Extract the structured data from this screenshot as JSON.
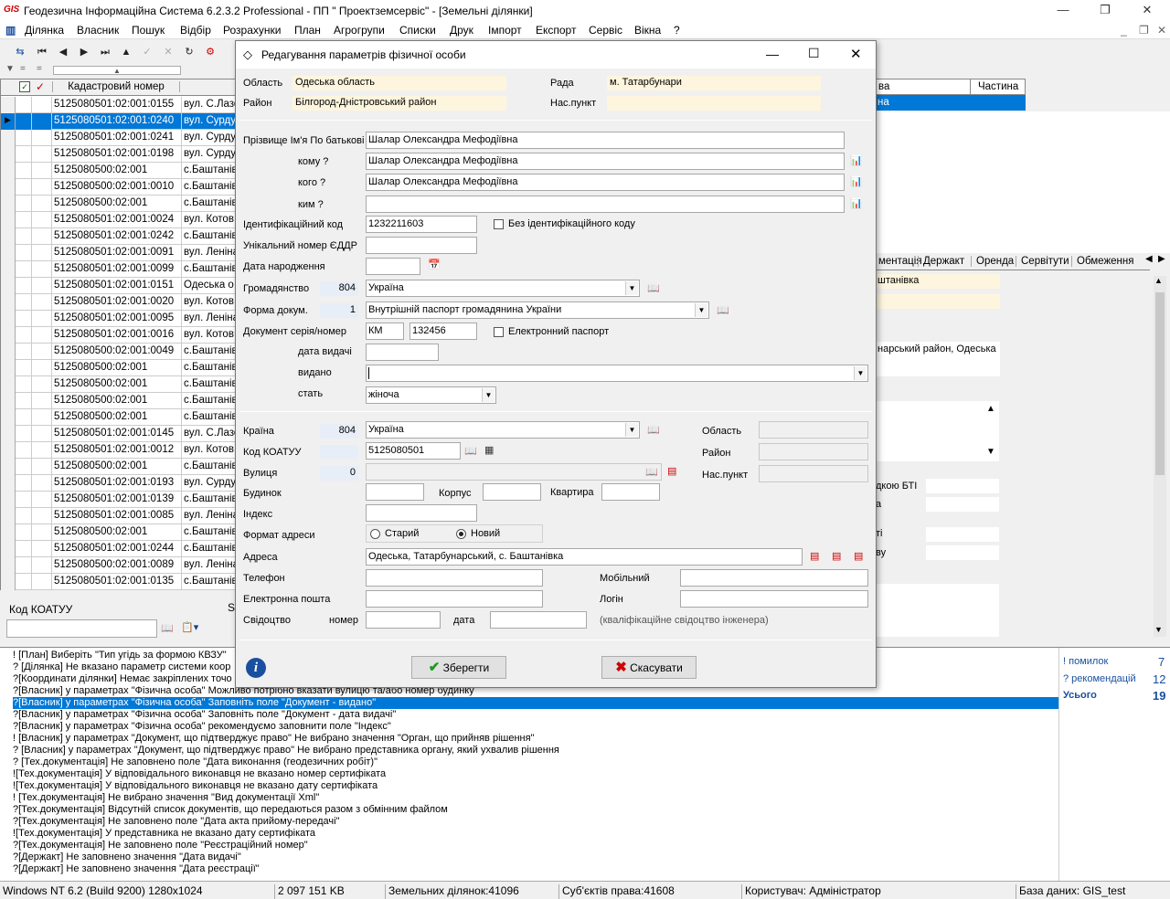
{
  "app": {
    "logo": "GIS",
    "title": "Геодезична Інформаційна Система  6.2.3.2 Professional - ПП \" Проектземсервіс\" - [Земельні ділянки]"
  },
  "menu": [
    "Ділянка",
    "Власник",
    "Пошук",
    "Відбір",
    "Розрахунки",
    "План",
    "Агрогрупи",
    "Списки",
    "Друк",
    "Імпорт",
    "Експорт",
    "Сервіс",
    "Вікна",
    "?"
  ],
  "grid": {
    "header_cad": "Кадастровий номер",
    "rows": [
      {
        "cad": "5125080501:02:001:0155",
        "addr": "вул. С.Лазо"
      },
      {
        "cad": "5125080501:02:001:0240",
        "addr": "вул. Сурдул",
        "selected": true
      },
      {
        "cad": "5125080501:02:001:0241",
        "addr": "вул. Сурдул"
      },
      {
        "cad": "5125080501:02:001:0198",
        "addr": "вул. Сурдул"
      },
      {
        "cad": "5125080500:02:001",
        "addr": "с.Баштанів"
      },
      {
        "cad": "5125080500:02:001:0010",
        "addr": "с.Баштанів"
      },
      {
        "cad": "5125080500:02:001",
        "addr": "с.Баштанів"
      },
      {
        "cad": "5125080501:02:001:0024",
        "addr": "вул. Котов"
      },
      {
        "cad": "5125080501:02:001:0242",
        "addr": "с.Баштанів"
      },
      {
        "cad": "5125080501:02:001:0091",
        "addr": "вул. Леніна"
      },
      {
        "cad": "5125080501:02:001:0099",
        "addr": "с.Баштанів"
      },
      {
        "cad": "5125080501:02:001:0151",
        "addr": "Одеська о"
      },
      {
        "cad": "5125080501:02:001:0020",
        "addr": "вул. Котов"
      },
      {
        "cad": "5125080501:02:001:0095",
        "addr": "вул. Леніна"
      },
      {
        "cad": "5125080501:02:001:0016",
        "addr": "вул. Котов"
      },
      {
        "cad": "5125080500:02:001:0049",
        "addr": "с.Баштанів"
      },
      {
        "cad": "5125080500:02:001",
        "addr": "с.Баштанів"
      },
      {
        "cad": "5125080500:02:001",
        "addr": "с.Баштанів"
      },
      {
        "cad": "5125080500:02:001",
        "addr": "с.Баштанів"
      },
      {
        "cad": "5125080500:02:001",
        "addr": "с.Баштанів"
      },
      {
        "cad": "5125080501:02:001:0145",
        "addr": "вул. С.Лазо"
      },
      {
        "cad": "5125080501:02:001:0012",
        "addr": "вул. Котов"
      },
      {
        "cad": "5125080500:02:001",
        "addr": "с.Баштанів"
      },
      {
        "cad": "5125080501:02:001:0193",
        "addr": "вул. Сурдул"
      },
      {
        "cad": "5125080501:02:001:0139",
        "addr": "с.Баштанів"
      },
      {
        "cad": "5125080501:02:001:0085",
        "addr": "вул. Леніна"
      },
      {
        "cad": "5125080500:02:001",
        "addr": "с.Баштанів"
      },
      {
        "cad": "5125080501:02:001:0244",
        "addr": "с.Баштанів"
      },
      {
        "cad": "5125080500:02:001:0089",
        "addr": "вул. Леніна"
      },
      {
        "cad": "5125080501:02:001:0135",
        "addr": "с.Баштанів"
      }
    ]
  },
  "left_footer": {
    "koatuu_label": "Код КОАТУУ",
    "s": "S"
  },
  "right_pane": {
    "col_a": "ва",
    "col_b": "Частина",
    "sel_a": "на",
    "tabs": [
      "ментація",
      "Держакт",
      "Оренда",
      "Сервітути",
      "Обмеження"
    ],
    "field1": "штанівка",
    "field2": "нарський район, Одеська",
    "label_bti": "дкою БТІ",
    "label_a": "а",
    "label_ti": "ті",
    "label_vu": "ву"
  },
  "dialog": {
    "title": "Редагування параметрів фізичної особи",
    "oblast_label": "Область",
    "oblast": "Одеська область",
    "rada_label": "Рада",
    "rada": "м. Татарбунари",
    "raion_label": "Район",
    "raion": "Білгород-Дністровський район",
    "naspunkt_label": "Нас.пункт",
    "naspunkt": "",
    "pib_label": "Прізвище Ім'я По батькові",
    "pib": "Шалар Олександра Мефодіївна",
    "komu_label": "кому ?",
    "komu": "Шалар Олександра Мефодіївна",
    "koho_label": "кого ?",
    "koho": "Шалар Олександра Мефодіївна",
    "kym_label": "ким ?",
    "kym": "",
    "idcode_label": "Ідентифікаційний код",
    "idcode": "1232211603",
    "no_id_label": "Без ідентифікаційного коду",
    "eddr_label": "Унікальний номер ЄДДР",
    "eddr": "",
    "birth_label": "Дата народження",
    "birth": "",
    "citizen_label": "Громадянство",
    "citizen_code": "804",
    "citizen": "Україна",
    "doctype_label": "Форма докум.",
    "doctype_code": "1",
    "doctype": "Внутрішній паспорт громадянина України",
    "docnum_label": "Документ серія/номер",
    "doc_series": "КМ",
    "doc_number": "132456",
    "epass_label": "Електронний паспорт",
    "issued_date_label": "дата видачі",
    "issued_date": "",
    "issued_by_label": "видано",
    "issued_by": "",
    "sex_label": "стать",
    "sex": "жіноча",
    "country_label": "Країна",
    "country_code": "804",
    "country": "Україна",
    "oblast2_label": "Область",
    "raion2_label": "Район",
    "naspunkt2_label": "Нас.пункт",
    "koatuu_label": "Код КОАТУУ",
    "koatuu": "5125080501",
    "street_label": "Вулиця",
    "street_code": "0",
    "house_label": "Будинок",
    "korpus_label": "Корпус",
    "kvartyra_label": "Квартира",
    "index_label": "Індекс",
    "format_label": "Формат адреси",
    "format_old": "Старий",
    "format_new": "Новий",
    "address_label": "Адреса",
    "address": "Одеська, Татарбунарський, с. Баштанівка",
    "phone_label": "Телефон",
    "mobile_label": "Мобільний",
    "email_label": "Електронна пошта",
    "login_label": "Логін",
    "cert_label": "Свідоцтво",
    "cert_num_label": "номер",
    "cert_date_label": "дата",
    "cert_note": "(кваліфікаційне свідоцтво інженера)",
    "save": "Зберегти",
    "cancel": "Скасувати"
  },
  "messages": [
    "! [План] Виберіть \"Тип угідь за формою КВЗУ\"",
    "? [Ділянка] Не вказано параметр системи коор",
    "?[Координати ділянки] Немає закріплених точо",
    "?[Власник]  у параметрах \"Фізична особа\" Можливо потрібно вказати вулицю та/або номер будинку",
    "?[Власник]  у параметрах \"Фізична особа\" Заповніть поле \"Документ - видано\"",
    "?[Власник]  у параметрах \"Фізична особа\" Заповніть поле \"Документ - дата видачі\"",
    "?[Власник]  у параметрах \"Фізична особа\" рекомендуємо заповнити поле \"Індекс\"",
    "! [Власник]  у параметрах \"Документ, що підтверджує право\" Не вибрано значення \"Орган, що прийняв рішення\"",
    "? [Власник]  у параметрах \"Документ, що підтверджує право\" Не вибрано представника органу, який ухвалив рішення",
    "? [Тех.документація] Не заповнено поле \"Дата виконання (геодезичних робіт)\"",
    "![Тех.документація] У відповідального виконавця не вказано номер сертифіката",
    "![Тех.документація] У відповідального виконавця не вказано дату сертифіката",
    "! [Тех.документація] Не вибрано значення \"Вид документації Xml\"",
    "?[Тех.документація] Відсутній список документів, що передаються разом з обмінним файлом",
    "?[Тех.документація] Не заповнено поле \"Дата акта прийому-передачі\"",
    "![Тех.документація] У представника не вказано дату сертифіката",
    "?[Тех.документація] Не заповнено поле \"Реєстраційний номер\"",
    "?[Держакт] Не заповнено значення \"Дата видачі\"",
    "?[Держакт] Не заповнено значення \"Дата реєстрації\""
  ],
  "summary": {
    "errors_label": "! помилок",
    "errors": "7",
    "recs_label": "? рекомендацій",
    "recs": "12",
    "total_label": "Усього",
    "total": "19"
  },
  "status": {
    "os": "Windows NT 6.2 (Build 9200) 1280x1024",
    "mem": "2 097 151 KB",
    "plots": "Земельних ділянок:41096",
    "subjects": "Суб'єктів права:41608",
    "user": "Користувач: Адміністратор",
    "db": "База даних: GIS_test"
  }
}
